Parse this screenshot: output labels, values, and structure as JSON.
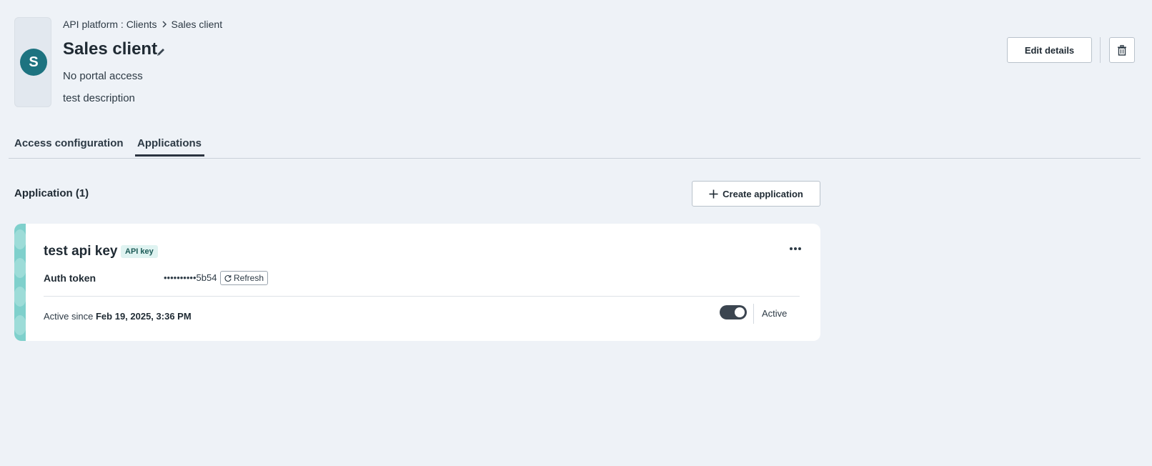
{
  "header": {
    "avatar_letter": "S",
    "breadcrumb": {
      "parent": "API platform : Clients",
      "current": "Sales client"
    },
    "title": "Sales client",
    "portal_access": "No portal access",
    "description": "test description",
    "edit_label": "Edit details"
  },
  "tabs": [
    {
      "label": "Access configuration",
      "active": false
    },
    {
      "label": "Applications",
      "active": true
    }
  ],
  "applications": {
    "section_title": "Application (1)",
    "create_label": "Create application",
    "items": [
      {
        "name": "test api key",
        "type_badge": "API key",
        "token_label": "Auth token",
        "token_value": "••••••••••5b54",
        "refresh_label": "Refresh",
        "active_since_prefix": "Active since",
        "active_since_date": "Feb 19, 2025, 3:36 PM",
        "status_label": "Active",
        "enabled": true
      }
    ]
  },
  "colors": {
    "background": "#eef2f7",
    "avatar": "#1d7380",
    "badge_bg": "#dff3f1",
    "stripe": "#7fd0cc",
    "toggle_on": "#3b4550"
  },
  "icons": [
    "chevron-right-icon",
    "pencil-icon",
    "trash-icon",
    "plus-icon",
    "more-horizontal-icon",
    "refresh-icon"
  ]
}
